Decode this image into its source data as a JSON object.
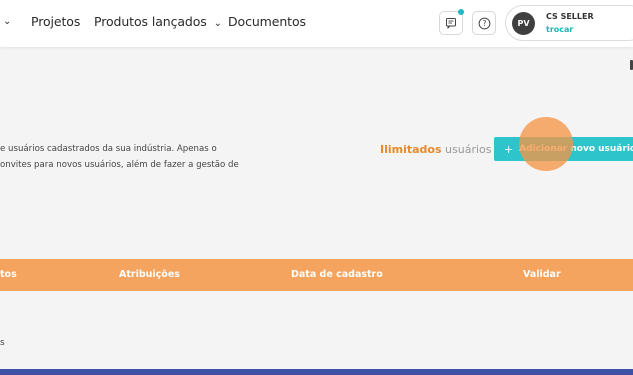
{
  "nav": {
    "items": [
      {
        "label": "Projetos"
      },
      {
        "label": "Produtos lançados"
      },
      {
        "label": "Documentos"
      }
    ]
  },
  "header": {
    "notifications_icon": "message-icon",
    "help_icon": "help-icon",
    "profile": {
      "initials": "PV",
      "name": "CS SELLER",
      "switch_label": "trocar"
    }
  },
  "main": {
    "description_line1": "e usuários cadastrados da sua indústria. Apenas o",
    "description_line2": "onvites para novos usuários, além de fazer a gestão de",
    "limit_strong": "Ilimitados",
    "limit_light": "usuários",
    "add_button_label": "Adicionar novo usuário",
    "add_button_icon": "+"
  },
  "table": {
    "headers": [
      "tos",
      "Atribuições",
      "Data de cadastro",
      "Validar"
    ],
    "row_fragment": "s"
  },
  "colors": {
    "accent": "#2ec4cc",
    "table_header": "#f4a45f",
    "limit_highlight": "#e98a2a",
    "bottom_bar": "#3f51a6"
  }
}
